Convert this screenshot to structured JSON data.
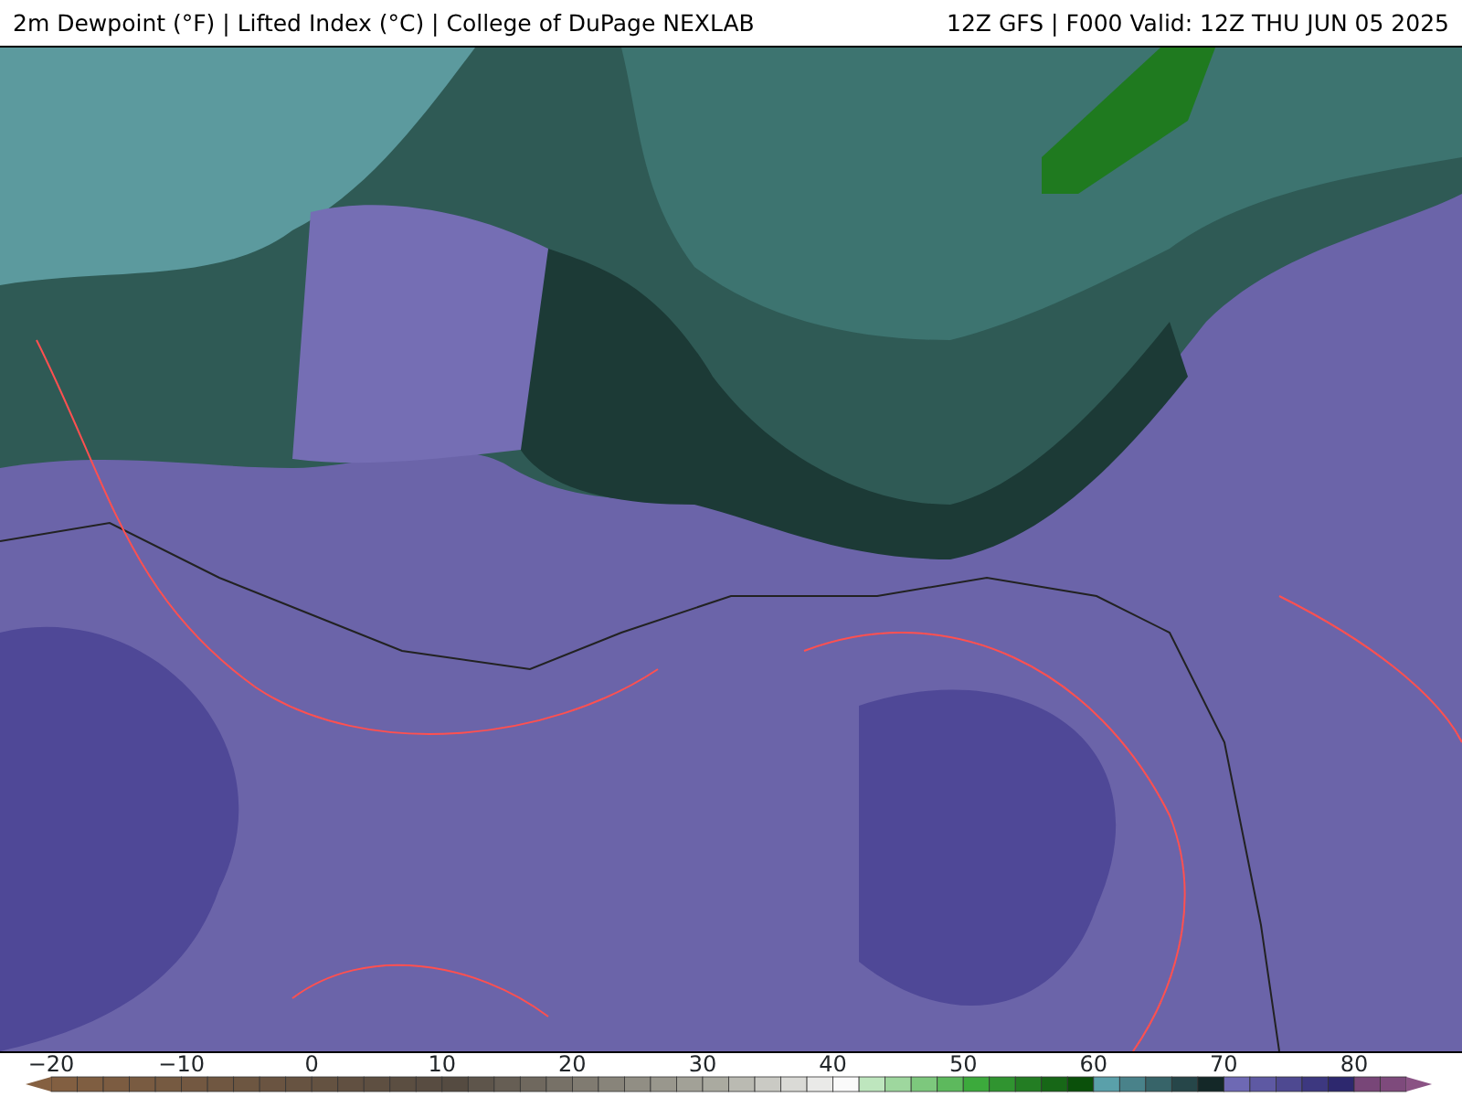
{
  "header": {
    "title": "2m Dewpoint (°F) | Lifted Index (°C) | College of DuPage NEXLAB",
    "run_info": "12Z GFS | F000 Valid: 12Z THU JUN 05 2025"
  },
  "colorbar": {
    "ticks": [
      "−20",
      "−10",
      "0",
      "10",
      "20",
      "30",
      "40",
      "50",
      "60",
      "70",
      "80"
    ]
  }
}
